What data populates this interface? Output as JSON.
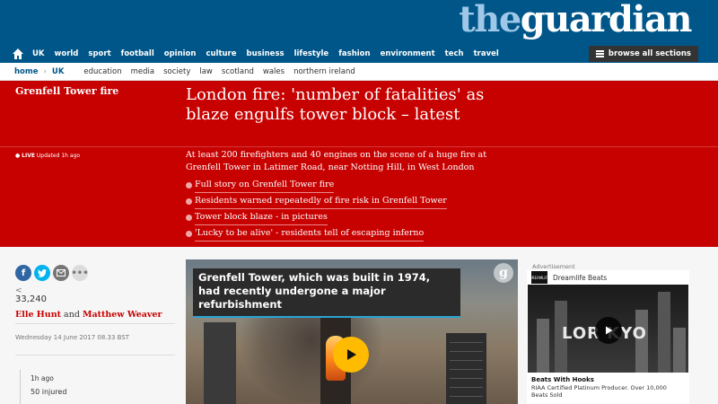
{
  "colors": {
    "brand_blue": "#005689",
    "news_red": "#c70000",
    "play_yellow": "#ffbb00"
  },
  "masthead": {
    "logo_pre": "the",
    "logo_main": "guardian"
  },
  "nav": {
    "home_icon": "home-icon",
    "items": [
      "UK",
      "world",
      "sport",
      "football",
      "opinion",
      "culture",
      "business",
      "lifestyle",
      "fashion",
      "environment",
      "tech",
      "travel"
    ],
    "browse_label": "browse all sections"
  },
  "subnav": {
    "breadcrumbs": [
      "home",
      "UK"
    ],
    "items": [
      "education",
      "media",
      "society",
      "law",
      "scotland",
      "wales",
      "northern ireland"
    ]
  },
  "article": {
    "series": "Grenfell Tower fire",
    "headline": "London fire: 'number of fatalities' as blaze engulfs tower block – latest",
    "live_label": "LIVE",
    "updated": "Updated 1h ago",
    "standfirst": "At least 200 firefighters and 40 engines on the scene of a huge fire at Grenfell Tower in Latimer Road, near Notting Hill, in West London",
    "links": [
      "Full story on Grenfell Tower fire",
      "Residents warned repeatedly of fire risk in Grenfell Tower",
      "Tower block blaze - in pictures",
      "'Lucky to be alive' - residents tell of escaping inferno"
    ],
    "share_count_icon": "<",
    "share_count": "33,240",
    "author1": "Elle Hunt",
    "and": "and",
    "author2": "Matthew Weaver",
    "dateline": "Wednesday 14 June 2017 08.33 BST",
    "timeline": {
      "time": "1h ago",
      "text": "50 injured"
    }
  },
  "video": {
    "caption": "Grenfell Tower, which was built in 1974, had recently undergone a major refurbishment",
    "logo": "g"
  },
  "ad": {
    "label": "Advertisement",
    "avatar_text": "DREAMLIFE",
    "channel": "Dreamlife Beats",
    "sign": "LOR  KYO",
    "title": "Beats With Hooks",
    "description": "RIAA Certified Platinum Producer. Over 10,000 Beats Sold"
  }
}
